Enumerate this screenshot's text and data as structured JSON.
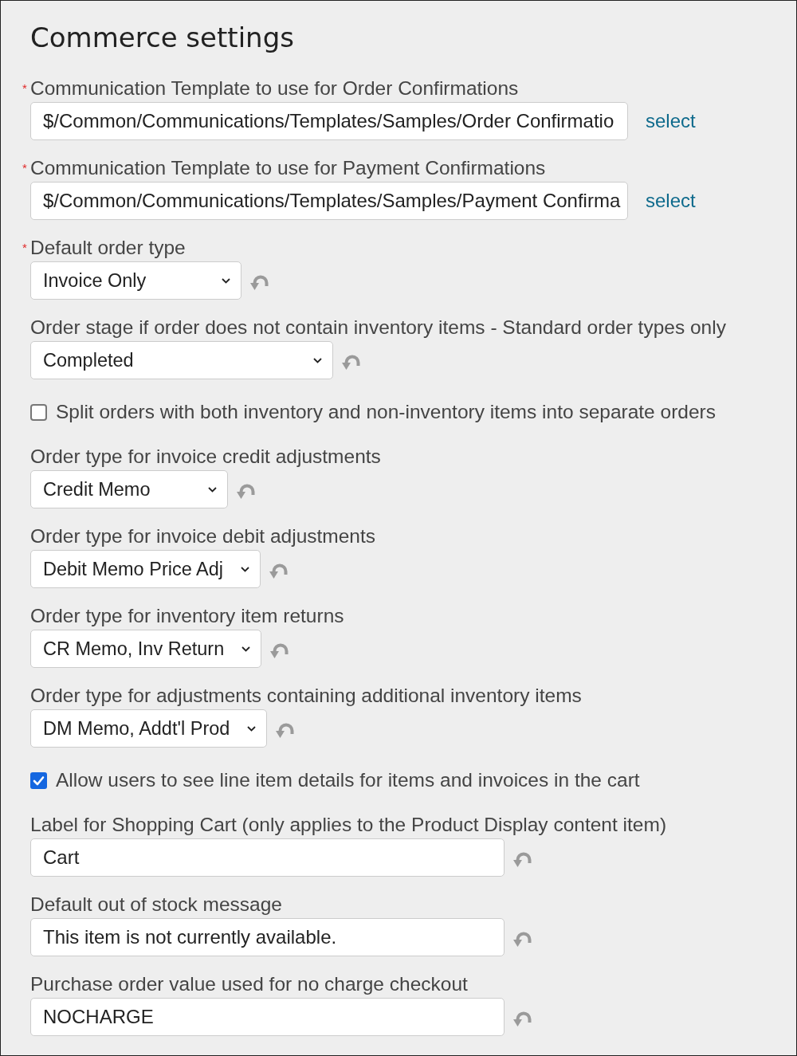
{
  "title": "Commerce settings",
  "settings": [
    {
      "kind": "template",
      "required_mark": "*",
      "label": "Communication Template to use for Order Confirmations",
      "value": "$/Common/Communications/Templates/Samples/Order Confirmatio",
      "link": "select"
    },
    {
      "kind": "template",
      "required_mark": "*",
      "label": "Communication Template to use for Payment Confirmations",
      "value": "$/Common/Communications/Templates/Samples/Payment Confirma",
      "link": "select"
    },
    {
      "kind": "dropdown",
      "required_mark": "*",
      "label": "Default order type",
      "value": "Invoice Only"
    },
    {
      "kind": "dropdown",
      "label": "Order stage if order does not contain inventory items - Standard order types only",
      "value": "Completed"
    },
    {
      "kind": "checkbox",
      "label": "Split orders with both inventory and non-inventory items into separate orders",
      "checked": false
    },
    {
      "kind": "dropdown",
      "label": "Order type for invoice credit adjustments",
      "value": "Credit Memo"
    },
    {
      "kind": "dropdown",
      "label": "Order type for invoice debit adjustments",
      "value": "Debit Memo Price Adj"
    },
    {
      "kind": "dropdown",
      "label": "Order type for inventory item returns",
      "value": "CR Memo, Inv Return"
    },
    {
      "kind": "dropdown",
      "label": "Order type for adjustments containing additional inventory items",
      "value": "DM Memo, Addt'l Prod"
    },
    {
      "kind": "checkbox",
      "label": "Allow users to see line item details for items and invoices in the cart",
      "checked": true
    },
    {
      "kind": "text",
      "label": "Label for Shopping Cart (only applies to the Product Display content item)",
      "value": "Cart"
    },
    {
      "kind": "text",
      "label": "Default out of stock message",
      "value": "This item is not currently available."
    },
    {
      "kind": "text",
      "label": "Purchase order value used for no charge checkout",
      "value": "NOCHARGE"
    }
  ]
}
